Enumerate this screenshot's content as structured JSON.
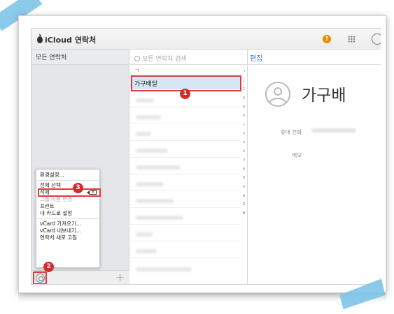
{
  "titlebar": {
    "brand_prefix": "iCloud",
    "app_name": "연락처",
    "alert": "!"
  },
  "sidebar": {
    "header": "모든 연락처",
    "menu": [
      {
        "label": "환경설정...",
        "disabled": false
      },
      {
        "label": "전체 선택",
        "disabled": false
      },
      {
        "label": "삭제",
        "disabled": false
      },
      {
        "label": "그룹 이름 변경",
        "disabled": true
      },
      {
        "label": "프린트",
        "disabled": false
      },
      {
        "label": "내 카드로 설정",
        "disabled": false
      },
      {
        "label": "vCard 가져오기...",
        "disabled": false
      },
      {
        "label": "vCard 내보내기...",
        "disabled": false
      },
      {
        "label": "연락처 새로 고침",
        "disabled": false
      }
    ],
    "add": "+"
  },
  "list": {
    "search_placeholder": "모든 연락처 검색",
    "section": "ㄱ",
    "selected_contact": "가구배달",
    "index": [
      "ㄱ",
      "ㄴ",
      "ㄷ",
      "ㄹ",
      "ㅁ",
      "ㅂ",
      "ㅅ",
      "ㅇ",
      "ㅈ",
      "ㅊ",
      "ㅋ",
      "ㅌ",
      "ㅍ",
      "ㅎ",
      "A",
      "Z",
      "#"
    ]
  },
  "detail": {
    "edit": "편집",
    "name": "가구배",
    "phone_label": "휴대 전화",
    "memo_label": "메모"
  },
  "annotations": {
    "step1": "1",
    "step2": "2",
    "step3": "3"
  },
  "colors": {
    "highlight": "#e23a3a",
    "badge": "#d62b2b",
    "accent": "#3b7ad0",
    "selected_row": "#d6e6f5"
  }
}
